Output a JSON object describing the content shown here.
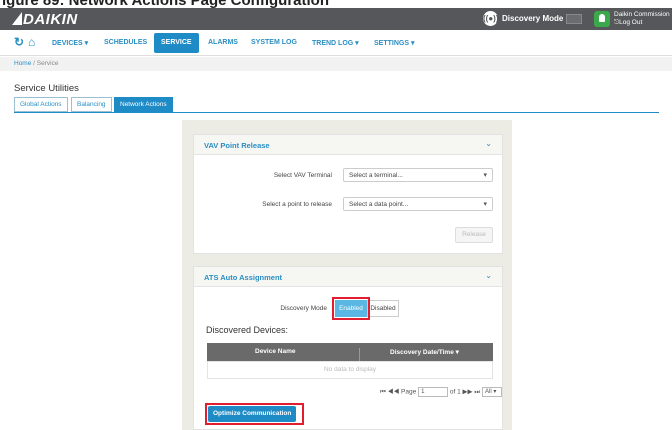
{
  "app": {
    "top_caption": "igure 89: Network Actions Page Configuration",
    "brand": "DAIKIN",
    "discovery_mode_label": "Discovery Mode",
    "user_name": "Daikin Commission",
    "logout_label": "Log Out"
  },
  "nav": {
    "items": [
      {
        "label": "DEVICES ▾"
      },
      {
        "label": "SCHEDULES"
      },
      {
        "label": "SERVICE"
      },
      {
        "label": "ALARMS"
      },
      {
        "label": "SYSTEM LOG"
      },
      {
        "label": "TREND LOG ▾"
      },
      {
        "label": "SETTINGS ▾"
      }
    ],
    "active_index": 2
  },
  "breadcrumb": {
    "home": "Home",
    "separator": "/",
    "current": "Service"
  },
  "page": {
    "title": "Service Utilities"
  },
  "tabs": [
    {
      "label": "Global Actions"
    },
    {
      "label": "Balancing"
    },
    {
      "label": "Network Actions"
    }
  ],
  "vav": {
    "title": "VAV Point Release",
    "terminal_label": "Select VAV Terminal",
    "terminal_value": "Select a terminal...",
    "point_label": "Select a point to release",
    "point_value": "Select a data point...",
    "release_button": "Release"
  },
  "ats": {
    "title": "ATS Auto Assignment",
    "discovery_mode_label": "Discovery Mode",
    "enabled_label": "Enabled",
    "disabled_label": "Disabled",
    "selected": "Enabled",
    "discovered_label": "Discovered Devices:",
    "col_device_name": "Device Name",
    "col_discovery_date": "Discovery Date/Time ▾",
    "empty_message": "No data to display",
    "pager_prefix": "⏮ ◀◀ Page",
    "page_value": "1",
    "pager_suffix": "of 1 ▶▶ ⏭",
    "page_size": "All",
    "optimize_button": "Optimize Communication"
  }
}
